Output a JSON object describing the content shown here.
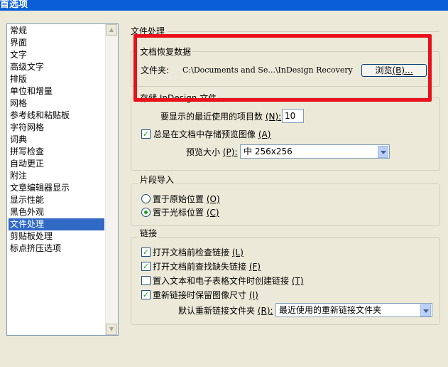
{
  "window": {
    "title": "首选项"
  },
  "categories": [
    {
      "label": "常规",
      "selected": false
    },
    {
      "label": "界面",
      "selected": false
    },
    {
      "label": "文字",
      "selected": false
    },
    {
      "label": "高级文字",
      "selected": false
    },
    {
      "label": "排版",
      "selected": false
    },
    {
      "label": "单位和增量",
      "selected": false
    },
    {
      "label": "网格",
      "selected": false
    },
    {
      "label": "参考线和粘贴板",
      "selected": false
    },
    {
      "label": "字符网格",
      "selected": false
    },
    {
      "label": "词典",
      "selected": false
    },
    {
      "label": "拼写检查",
      "selected": false
    },
    {
      "label": "自动更正",
      "selected": false
    },
    {
      "label": "附注",
      "selected": false
    },
    {
      "label": "文章编辑器显示",
      "selected": false
    },
    {
      "label": "显示性能",
      "selected": false
    },
    {
      "label": "黑色外观",
      "selected": false
    },
    {
      "label": "文件处理",
      "selected": true
    },
    {
      "label": "剪贴板处理",
      "selected": false
    },
    {
      "label": "标点挤压选项",
      "selected": false
    }
  ],
  "section_title": "文件处理",
  "recovery": {
    "title": "文档恢复数据",
    "folder_label": "文件夹:",
    "folder_path": "C:\\Documents and Se...\\InDesign Recovery",
    "browse_label": "浏览",
    "browse_key": "(B)...",
    "highlight_color": "#e8101a"
  },
  "save": {
    "title": "存储 InDesign 文件",
    "recent_label": "要显示的最近使用的项目数",
    "recent_key": "(N):",
    "recent_value": "10",
    "preview_label": "总是在文档中存储预览图像",
    "preview_key": "(A)",
    "preview_checked": true,
    "size_label": "预览大小",
    "size_key": "(P):",
    "size_value": "中  256x256"
  },
  "snippet": {
    "title": "片段导入",
    "opt1_label": "置于原始位置",
    "opt1_key": "(O)",
    "opt1_checked": false,
    "opt2_label": "置于光标位置",
    "opt2_key": "(C)",
    "opt2_checked": true
  },
  "links": {
    "title": "链接",
    "check1_label": "打开文档前检查链接",
    "check1_key": "(L)",
    "check1_checked": true,
    "check2_label": "打开文档前查找缺失链接",
    "check2_key": "(F)",
    "check2_checked": true,
    "check3_label": "置入文本和电子表格文件时创建链接",
    "check3_key": "(T)",
    "check3_checked": false,
    "check4_label": "重新链接时保留图像尺寸",
    "check4_key": "(I)",
    "check4_checked": true,
    "default_label": "默认重新链接文件夹",
    "default_key": "(R):",
    "default_value": "最近使用的重新链接文件夹"
  }
}
